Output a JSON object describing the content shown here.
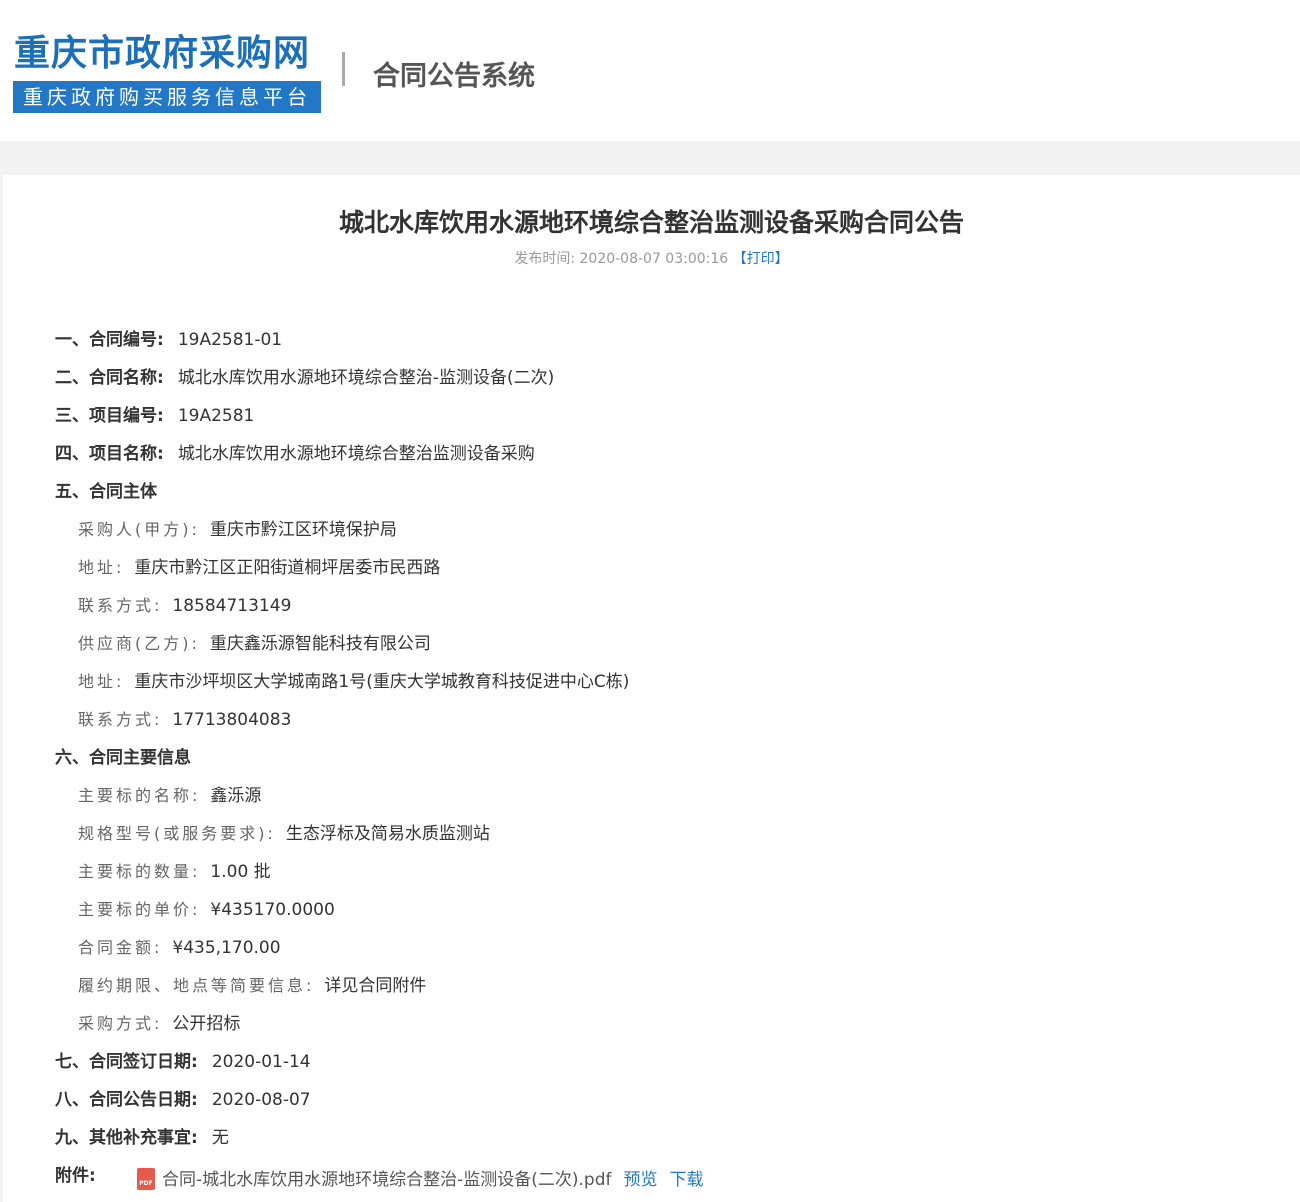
{
  "header": {
    "site_title": "重庆市政府采购网",
    "site_subtitle": "重庆政府购买服务信息平台",
    "system_name": "合同公告系统"
  },
  "article": {
    "title": "城北水库饮用水源地环境综合整治监测设备采购合同公告",
    "publish_label": "发布时间:",
    "publish_time": "2020-08-07 03:00:16",
    "print_label": "【打印】"
  },
  "fields": {
    "contract_no": {
      "label": "一、合同编号:",
      "value": "19A2581-01"
    },
    "contract_name": {
      "label": "二、合同名称:",
      "value": "城北水库饮用水源地环境综合整治-监测设备(二次)"
    },
    "project_no": {
      "label": "三、项目编号:",
      "value": "19A2581"
    },
    "project_name": {
      "label": "四、项目名称:",
      "value": "城北水库饮用水源地环境综合整治监测设备采购"
    },
    "parties": {
      "label": "五、合同主体"
    },
    "buyer": {
      "label": "采购人(甲方):",
      "value": "重庆市黔江区环境保护局"
    },
    "buyer_addr": {
      "label": "地址:",
      "value": "重庆市黔江区正阳街道桐坪居委市民西路"
    },
    "buyer_contact": {
      "label": "联系方式:",
      "value": "18584713149"
    },
    "supplier": {
      "label": "供应商(乙方):",
      "value": "重庆鑫泺源智能科技有限公司"
    },
    "supplier_addr": {
      "label": "地址:",
      "value": "重庆市沙坪坝区大学城南路1号(重庆大学城教育科技促进中心C栋)"
    },
    "supplier_contact": {
      "label": "联系方式:",
      "value": "17713804083"
    },
    "main_info": {
      "label": "六、合同主要信息"
    },
    "item_name": {
      "label": "主要标的名称:",
      "value": "鑫泺源"
    },
    "spec": {
      "label": "规格型号(或服务要求):",
      "value": "生态浮标及简易水质监测站"
    },
    "quantity": {
      "label": "主要标的数量:",
      "value": "1.00 批"
    },
    "unit_price": {
      "label": "主要标的单价:",
      "value": "¥435170.0000"
    },
    "amount": {
      "label": "合同金额:",
      "value": "¥435,170.00"
    },
    "term": {
      "label": "履约期限、地点等简要信息:",
      "value": "详见合同附件"
    },
    "method": {
      "label": "采购方式:",
      "value": "公开招标"
    },
    "sign_date": {
      "label": "七、合同签订日期:",
      "value": "2020-01-14"
    },
    "notice_date": {
      "label": "八、合同公告日期:",
      "value": "2020-08-07"
    },
    "other": {
      "label": "九、其他补充事宜:",
      "value": "无"
    }
  },
  "attachment": {
    "label": "附件:",
    "icon": "pdf-icon",
    "icon_text": "PDF",
    "file_name": "合同-城北水库饮用水源地环境综合整治-监测设备(二次).pdf",
    "preview_label": "预览",
    "download_label": "下载"
  }
}
